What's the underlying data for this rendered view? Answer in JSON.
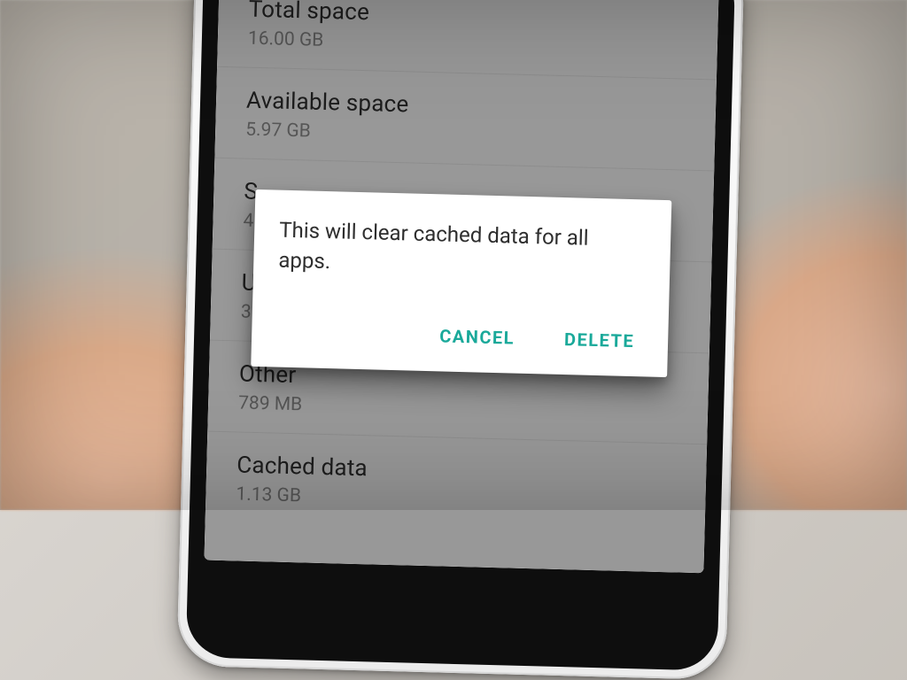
{
  "storage": {
    "rows": [
      {
        "title": "Total space",
        "sub": "16.00 GB"
      },
      {
        "title": "Available space",
        "sub": "5.97 GB"
      },
      {
        "title": "S",
        "sub": "4."
      },
      {
        "title": "U",
        "sub": "3."
      },
      {
        "title": "Other",
        "sub": "789 MB"
      },
      {
        "title": "Cached data",
        "sub": "1.13 GB"
      }
    ]
  },
  "dialog": {
    "message": "This will clear cached data for all apps.",
    "cancel_label": "CANCEL",
    "delete_label": "DELETE",
    "accent": "#1aa99a"
  }
}
